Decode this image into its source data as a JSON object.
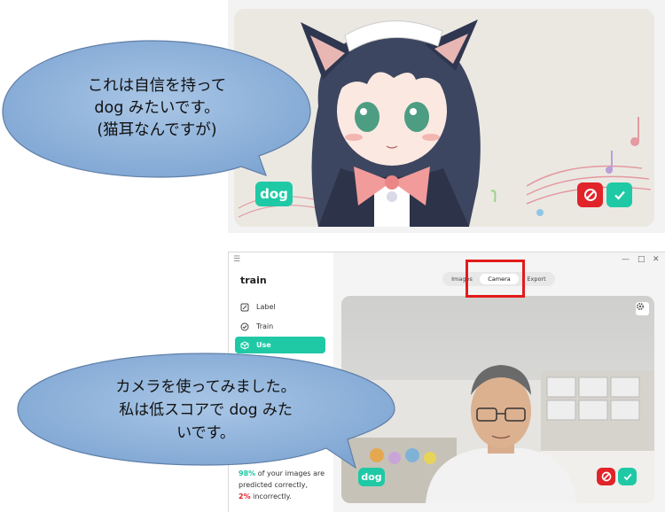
{
  "top": {
    "label": "dog"
  },
  "app": {
    "title": "train",
    "nav": [
      {
        "label": "Label"
      },
      {
        "label": "Train"
      },
      {
        "label": "Use"
      }
    ],
    "tabs": {
      "images": "Images",
      "camera": "Camera",
      "export": "Export"
    },
    "label": "dog",
    "stats": {
      "good_pct": "98%",
      "good_text": " of your images are predicted correctly,",
      "bad_pct": "2%",
      "bad_text": " incorrectly."
    }
  },
  "bubbles": {
    "top": [
      "これは自信を持って",
      "dog みたいです。",
      "(猫耳なんですが)"
    ],
    "bottom": [
      "カメラを使ってみました。",
      "私は低スコアで dog みた",
      "いです。"
    ]
  },
  "colors": {
    "accent": "#1fc9a5",
    "danger": "#e0242a",
    "bubble_fill": "#8eb2da",
    "highlight": "#e21b1b"
  }
}
